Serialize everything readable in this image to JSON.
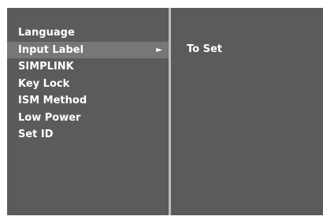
{
  "menu": {
    "items": [
      {
        "label": "Language"
      },
      {
        "label": "Input Label",
        "arrow": "►"
      },
      {
        "label": "SIMPLINK"
      },
      {
        "label": "Key Lock"
      },
      {
        "label": "ISM Method"
      },
      {
        "label": "Low Power"
      },
      {
        "label": "Set ID"
      }
    ],
    "selected_index": 1
  },
  "submenu": {
    "items": [
      {
        "label": "To Set"
      }
    ]
  },
  "colors": {
    "panel": "#5b5b5b",
    "highlight": "#777777",
    "divider": "#bdbdbd",
    "text": "#ffffff"
  }
}
